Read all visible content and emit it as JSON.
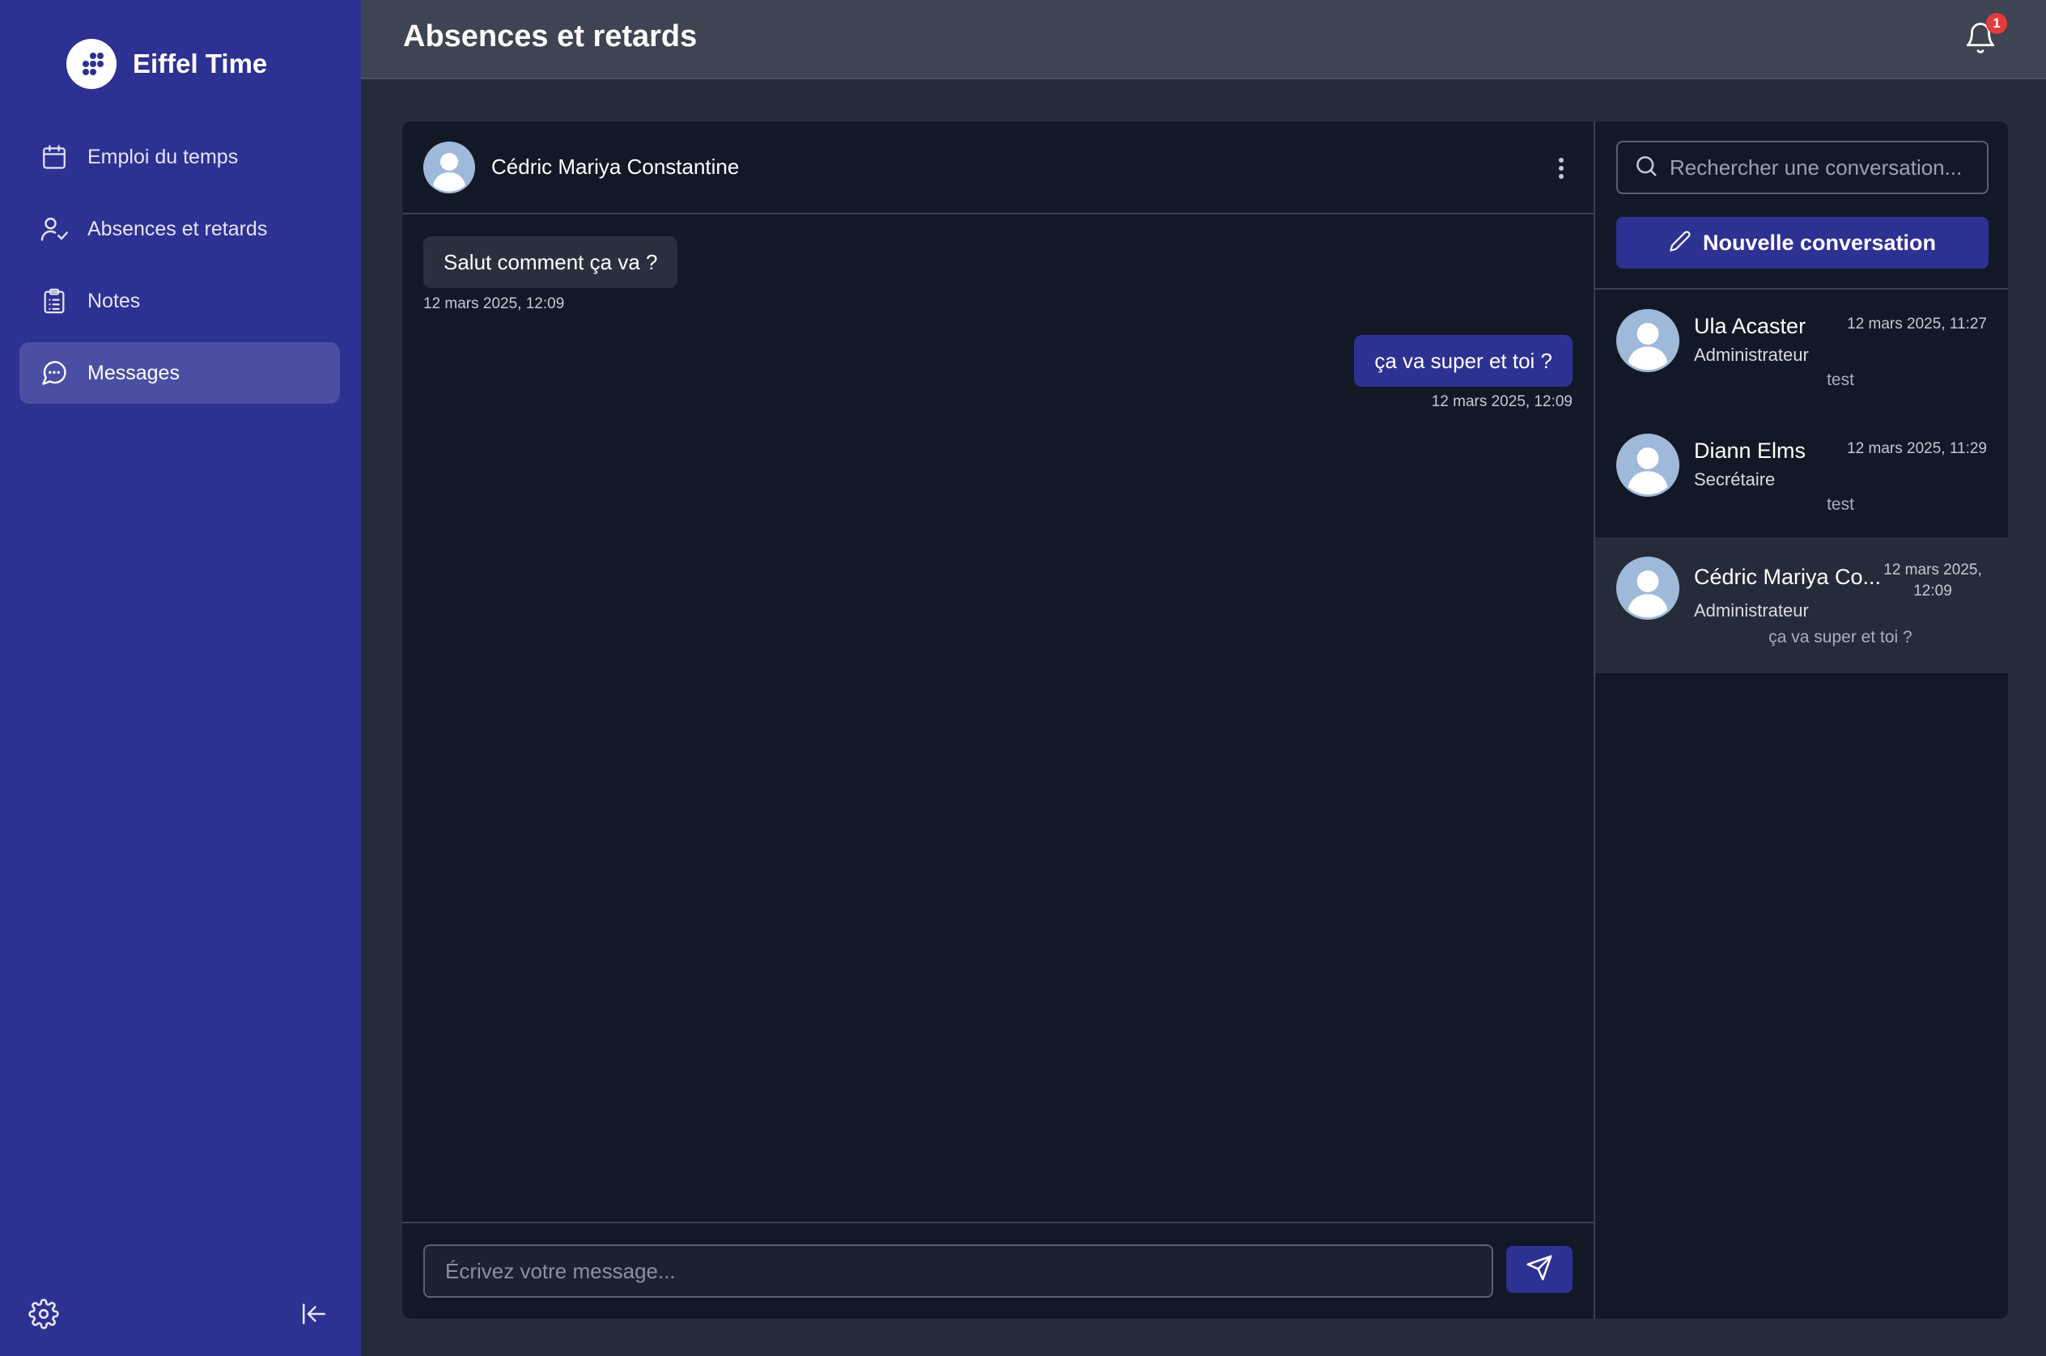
{
  "app": {
    "name": "Eiffel Time"
  },
  "sidebar": {
    "items": [
      {
        "label": "Emploi du temps",
        "icon": "calendar-icon"
      },
      {
        "label": "Absences et retards",
        "icon": "user-check-icon"
      },
      {
        "label": "Notes",
        "icon": "clipboard-icon"
      },
      {
        "label": "Messages",
        "icon": "message-circle-icon",
        "active": true
      }
    ],
    "bottom_icons": [
      "settings-icon",
      "collapse-sidebar-icon"
    ]
  },
  "header": {
    "title": "Absences et retards",
    "notifications_count": "1"
  },
  "chat": {
    "contact_name": "Cédric Mariya Constantine",
    "messages": [
      {
        "direction": "in",
        "text": "Salut comment ça va ?",
        "time": "12 mars 2025, 12:09"
      },
      {
        "direction": "out",
        "text": "ça va super et toi ?",
        "time": "12 mars 2025, 12:09"
      }
    ],
    "composer_placeholder": "Écrivez votre message..."
  },
  "conversations": {
    "search_placeholder": "Rechercher une conversation...",
    "new_button_label": "Nouvelle conversation",
    "items": [
      {
        "name": "Ula Acaster",
        "role": "Administrateur",
        "time": "12 mars 2025, 11:27",
        "preview": "test"
      },
      {
        "name": "Diann Elms",
        "role": "Secrétaire",
        "time": "12 mars 2025, 11:29",
        "preview": "test"
      },
      {
        "name": "Cédric Mariya Co...",
        "role": "Administrateur",
        "time_line1": "12 mars 2025,",
        "time_line2": "12:09",
        "preview": "ça va super et toi ?",
        "active": true
      }
    ]
  },
  "colors": {
    "sidebar": "#2d3192",
    "accent": "#2d3192",
    "panel": "#131826",
    "background": "#252b38",
    "badge": "#e23c3c"
  }
}
